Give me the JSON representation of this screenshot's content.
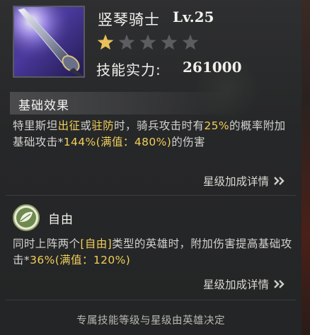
{
  "skill": {
    "name": "竖琴骑士",
    "level": "Lv.25",
    "stars_filled": 1,
    "stars_total": 5,
    "power_label": "技能实力:",
    "power_value": "261000"
  },
  "section_basic": {
    "title": "基础效果",
    "desc_segments": [
      {
        "t": "特里斯坦",
        "h": false
      },
      {
        "t": "出征",
        "h": true
      },
      {
        "t": "或",
        "h": false
      },
      {
        "t": "驻防",
        "h": true
      },
      {
        "t": "时，骑兵攻击时有",
        "h": false
      },
      {
        "t": "25%",
        "h": true
      },
      {
        "t": "的概率附加基础攻击*",
        "h": false
      },
      {
        "t": "144%(满值：480%)",
        "h": true
      },
      {
        "t": "的伤害",
        "h": false
      }
    ],
    "link_label": "星级加成详情"
  },
  "section_free": {
    "title": "自由",
    "badge_icon": "leaf-icon",
    "desc_segments": [
      {
        "t": "同时上阵两个",
        "h": false
      },
      {
        "t": "[自由]",
        "h": true
      },
      {
        "t": "类型的英雄时，附加伤害提高基础攻击*",
        "h": false
      },
      {
        "t": "36%(满值：120%)",
        "h": true
      }
    ],
    "link_label": "星级加成详情"
  },
  "footer_note": "专属技能等级与星级由英雄决定",
  "colors": {
    "highlight": "#f1cf5a",
    "star_filled": "#e9c15a",
    "star_empty": "#5c5d5f",
    "badge_green": "#6f8a4e"
  }
}
